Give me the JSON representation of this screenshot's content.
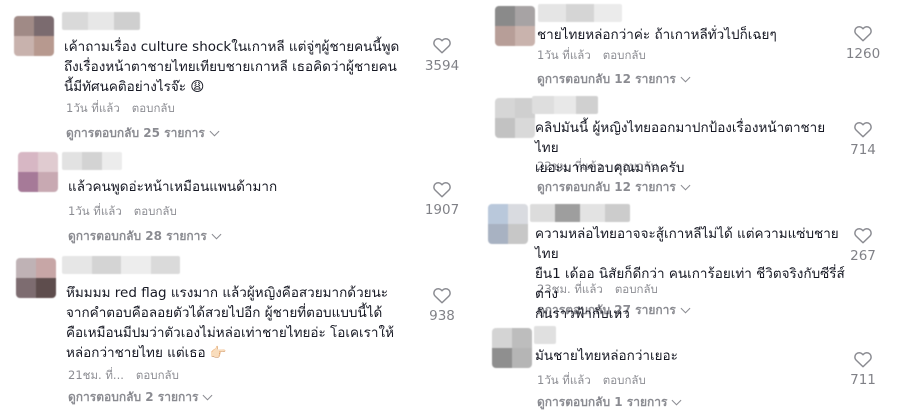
{
  "colors": {
    "text": "#161823",
    "muted": "#8a8b91"
  },
  "left": [
    {
      "text": "เค้าถามเรื่อง culture shockในเกาหลี แต่จู่ๆผู้ชายคนนี้พูด\nถึงเรื่องหน้าตาชายไทยเทียบชายเกาหลี เธอคิดว่าผู้ชายคน\nนี้มีทัศนคติอย่างไรจ๊ะ 😩",
      "time": "1วัน ที่แล้ว",
      "reply": "ตอบกลับ",
      "view_replies": "ดูการตอบกลับ 25 รายการ",
      "likes": "3594"
    },
    {
      "text": "แล้วคนพูดอ่ะหน้าเหมือนแพนด้ามาก",
      "time": "1วัน ที่แล้ว",
      "reply": "ตอบกลับ",
      "view_replies": "ดูการตอบกลับ 28 รายการ",
      "likes": "1907"
    },
    {
      "text": "หึมมมม red flag แรงมาก แล้วผู้หญิงคือสวยมากด้วยนะ\nจากคำตอบคือลอยตัวได้สวยไปอีก ผู้ชายที่ตอบแบบนี้ได้\nคือเหมือนมีปมว่าตัวเองไม่หล่อเท่าชายไทยอ่ะ โอเคเราให้\nหล่อกว่าชายไทย แต่เธอ 👉🏻",
      "time": "21ชม. ที่...",
      "reply": "ตอบกลับ",
      "view_replies": "ดูการตอบกลับ 2 รายการ",
      "likes": "938"
    }
  ],
  "right": [
    {
      "text": "ชายไทยหล่อกว่าค่ะ ถ้าเกาหลีทั่วไปก็เฉยๆ",
      "time": "1วัน ที่แล้ว",
      "reply": "ตอบกลับ",
      "view_replies": "ดูการตอบกลับ 12 รายการ",
      "likes": "1260"
    },
    {
      "text": "คลิปมันนี้ ผู้หญิงไทยออกมาปกป้องเรื่องหน้าตาชายไทย\nเยอะมากขอบคุณมากครับ",
      "time": "22ชม. ที่แล้ว",
      "reply": "ตอบกลับ",
      "view_replies": "ดูการตอบกลับ 12 รายการ",
      "likes": "714"
    },
    {
      "text": "ความหล่อไทยอาจจะสู้เกาหลีไม่ได้ แต่ความแซ่บชายไทย\nยืน1 เด้ออ นิสัยก็ดีกว่า คนเการ้อยเท่า ชีวิตจริงกับซีรี่ส์ต่าง\nกันราวฟ้ากับเหว",
      "time": "23ชม. ที่แล้ว",
      "reply": "ตอบกลับ",
      "view_replies": "ดูการตอบกลับ 27 รายการ",
      "likes": "267"
    },
    {
      "text": "มันชายไทยหล่อกว่าเยอะ",
      "time": "1วัน ที่แล้ว",
      "reply": "ตอบกลับ",
      "view_replies": "ดูการตอบกลับ 1 รายการ",
      "likes": "711"
    }
  ]
}
